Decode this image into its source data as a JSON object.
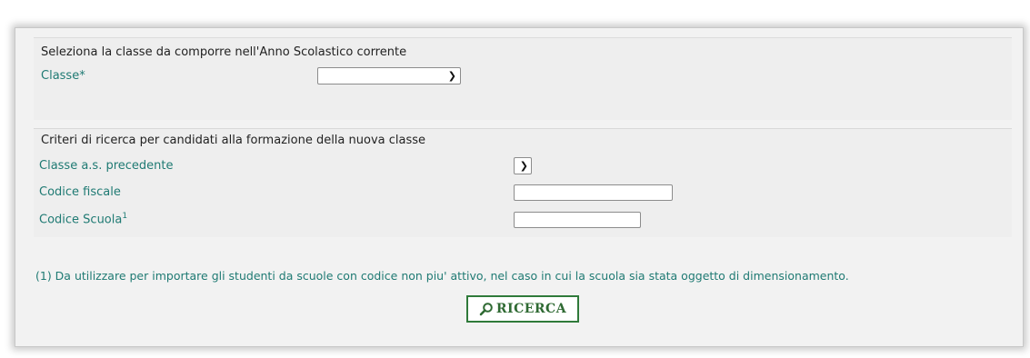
{
  "section_class": {
    "heading": "Seleziona la classe da comporre nell'Anno Scolastico corrente",
    "classe_label": "Classe*",
    "classe_selected": ""
  },
  "section_search": {
    "heading": "Criteri di ricerca per candidati alla formazione della nuova classe",
    "prev_class_label": "Classe a.s. precedente",
    "prev_class_selected": "",
    "fiscal_code_label": "Codice fiscale",
    "fiscal_code_value": "",
    "school_code_label": "Codice Scuola",
    "school_code_sup": "1",
    "school_code_value": ""
  },
  "footnote": "(1) Da utilizzare per importare gli studenti da scuole con codice non piu' attivo, nel caso in cui la scuola sia stata oggetto di dimensionamento.",
  "search_button": {
    "label": "RICERCA",
    "icon": "magnifier-icon"
  },
  "colors": {
    "label_teal": "#1f7a73",
    "button_border": "#2f7a3a",
    "panel_bg": "#eeeeee"
  }
}
